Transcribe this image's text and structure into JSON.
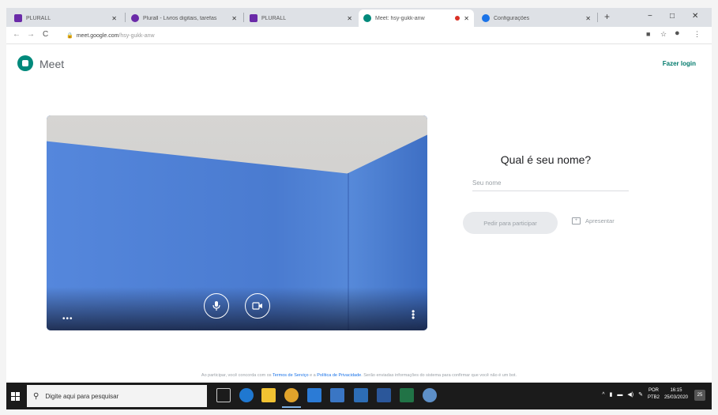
{
  "browser": {
    "tabs": [
      {
        "title": "PLURALL",
        "favicon_color": "#6a2aa8",
        "active": false
      },
      {
        "title": "Plurall - Livros digitais, tarefas",
        "favicon_color": "#6a2aa8",
        "active": false
      },
      {
        "title": "PLURALL",
        "favicon_color": "#6a2aa8",
        "active": false
      },
      {
        "title": "Meet: hsy-gukk-anw",
        "favicon_color": "#00897b",
        "active": true
      },
      {
        "title": "Configurações",
        "favicon_color": "#1a73e8",
        "active": false
      }
    ],
    "new_tab": "+",
    "window_controls": {
      "minimize": "−",
      "maximize": "□",
      "close": "✕"
    },
    "url_host": "meet.google.com",
    "url_path": "/hsy-gukk-anw"
  },
  "meet": {
    "app_name": "Meet",
    "login_label": "Fazer login",
    "join_title": "Qual é seu nome?",
    "name_placeholder": "Seu nome",
    "join_button": "Pedir para participar",
    "present_button": "Apresentar",
    "legal": {
      "prefix": "Ao participar, você concorda com os ",
      "terms": "Termos de Serviço",
      "and": " e a ",
      "privacy": "Política de Privacidade",
      "suffix": ". Serão enviadas informações do sistema para confirmar que você não é um bot."
    }
  },
  "taskbar": {
    "search_placeholder": "Digite aqui para pesquisar",
    "apps": [
      {
        "icon": "task-view-icon",
        "color": "#1b1b1b"
      },
      {
        "icon": "edge-icon",
        "color": "#1f78d1"
      },
      {
        "icon": "file-explorer-icon",
        "color": "#f1c232"
      },
      {
        "icon": "chrome-icon",
        "color": "#e0a32b"
      },
      {
        "icon": "outlook-icon",
        "color": "#2b7bd6"
      },
      {
        "icon": "photos-icon",
        "color": "#3a76c4"
      },
      {
        "icon": "mail-icon",
        "color": "#2d6db5"
      },
      {
        "icon": "word-icon",
        "color": "#2b579a"
      },
      {
        "icon": "excel-icon",
        "color": "#217346"
      },
      {
        "icon": "paint-icon",
        "color": "#5d8fc7"
      }
    ],
    "language": {
      "line1": "POR",
      "line2": "PTB2"
    },
    "time": "16:15",
    "date": "25/03/2020",
    "notifications": "25"
  }
}
